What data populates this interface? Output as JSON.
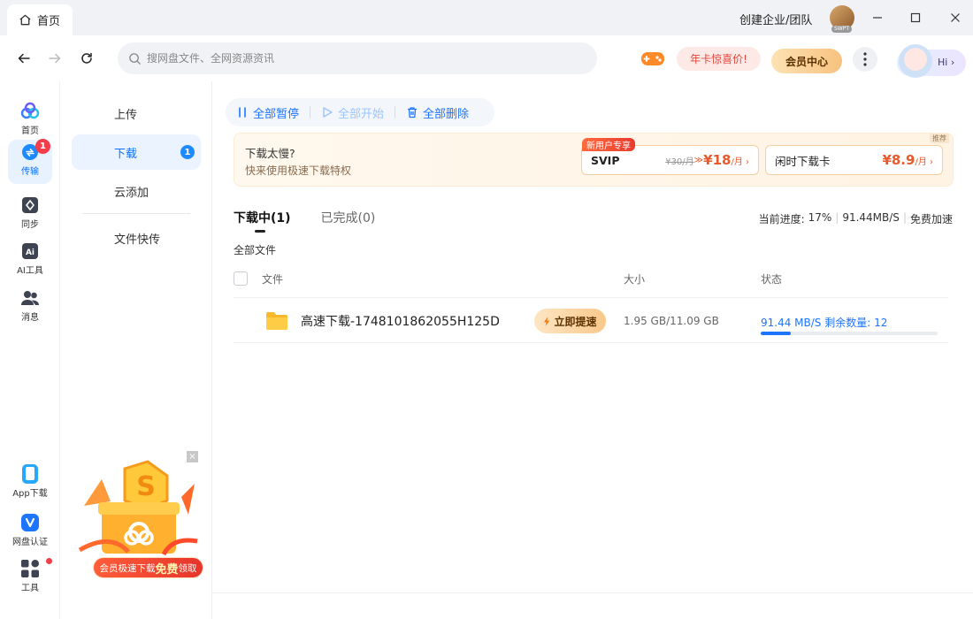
{
  "titlebar": {
    "tab_label": "首页",
    "enterprise": "创建企业/团队",
    "avatar_tag": "SWPT"
  },
  "navbar": {
    "search_placeholder": "搜网盘文件、全网资源资讯",
    "promo": "年卡惊喜价!",
    "vip_center": "会员中心",
    "hi": "Hi"
  },
  "rail": {
    "items": [
      {
        "label": "首页",
        "icon": "cloud-logo-icon"
      },
      {
        "label": "传输",
        "icon": "transfer-icon",
        "badge": "1"
      },
      {
        "label": "同步",
        "icon": "sync-icon"
      },
      {
        "label": "AI工具",
        "icon": "ai-tools-icon"
      },
      {
        "label": "消息",
        "icon": "message-icon"
      },
      {
        "label": "App下载",
        "icon": "phone-icon"
      },
      {
        "label": "网盘认证",
        "icon": "verify-icon"
      },
      {
        "label": "工具",
        "icon": "tools-icon"
      }
    ]
  },
  "subnav": {
    "items": [
      {
        "label": "上传"
      },
      {
        "label": "下载",
        "badge": "1"
      },
      {
        "label": "云添加"
      },
      {
        "label": "文件快传"
      }
    ],
    "ad_cta_pre": "会员极速下载",
    "ad_cta_bold": "免费",
    "ad_cta_post": "领取",
    "ad_close": "×"
  },
  "toolbar": {
    "pause_all": "全部暂停",
    "start_all": "全部开始",
    "delete_all": "全部删除"
  },
  "banner": {
    "title": "下载太慢?",
    "subtitle": "快来使用极速下载特权",
    "new_user_tag": "新用户专享",
    "recommend_tag": "推荐",
    "svip": {
      "name": "SVIP",
      "old_price": "¥30/月",
      "arrow": " ≫ ",
      "price": "¥18",
      "unit": "/月 ›"
    },
    "idle": {
      "name": "闲时下载卡",
      "price": "¥8.9",
      "unit": "/月 ›"
    }
  },
  "tabs": {
    "downloading": "下载中(1)",
    "completed": "已完成(0)"
  },
  "progress": {
    "label": "当前进度:",
    "percent": "17%",
    "speed": "91.44MB/S",
    "free_boost": "免费加速"
  },
  "list": {
    "all_files": "全部文件",
    "col_file": "文件",
    "col_size": "大小",
    "col_status": "状态",
    "rows": [
      {
        "name": "高速下载-1748101862055H125D",
        "speedup": "立即提速",
        "size": "1.95 GB/11.09 GB",
        "status": "91.44 MB/S 剩余数量: 12",
        "progress": 0.17
      }
    ]
  },
  "colors": {
    "accent": "#1d74ff",
    "badge_red": "#f33d4b",
    "promo_red": "#e5463b"
  }
}
